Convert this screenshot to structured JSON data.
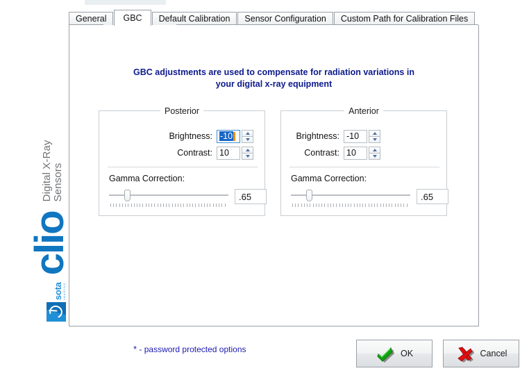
{
  "window": {
    "tabs": [
      {
        "label": "General",
        "active": false
      },
      {
        "label": "GBC",
        "active": true
      },
      {
        "label": "Default Calibration",
        "active": false
      },
      {
        "label": "Sensor Configuration",
        "active": false
      },
      {
        "label": "Custom Path for Calibration Files",
        "active": false
      }
    ]
  },
  "branding": {
    "product": "clio",
    "tagline_line1": "Digital X-Ray",
    "tagline_line2": "Sensors",
    "company": "sota",
    "company_sub": "IMAGING",
    "brand_color": "#1076c0",
    "tagline_color": "#6f7276"
  },
  "main": {
    "heading_line1": "GBC adjustments are used to compensate for radiation variations in",
    "heading_line2": "your digital x-ray equipment",
    "heading_color": "#0d1a8c",
    "groups": [
      {
        "title": "Posterior",
        "brightness_label": "Brightness:",
        "brightness_value": "-10",
        "brightness_focused": true,
        "contrast_label": "Contrast:",
        "contrast_value": "10",
        "gamma_label": "Gamma Correction:",
        "gamma_value": ".65",
        "gamma_slider_percent": 13
      },
      {
        "title": "Anterior",
        "brightness_label": "Brightness:",
        "brightness_value": "-10",
        "brightness_focused": false,
        "contrast_label": "Contrast:",
        "contrast_value": "10",
        "gamma_label": "Gamma Correction:",
        "gamma_value": ".65",
        "gamma_slider_percent": 13
      }
    ]
  },
  "footer": {
    "password_star": "*",
    "password_note": "- password protected options",
    "password_note_color": "#1a1ab0",
    "ok_label": "OK",
    "cancel_label": "Cancel",
    "ok_icon": "green-check-icon",
    "cancel_icon": "red-x-icon"
  }
}
